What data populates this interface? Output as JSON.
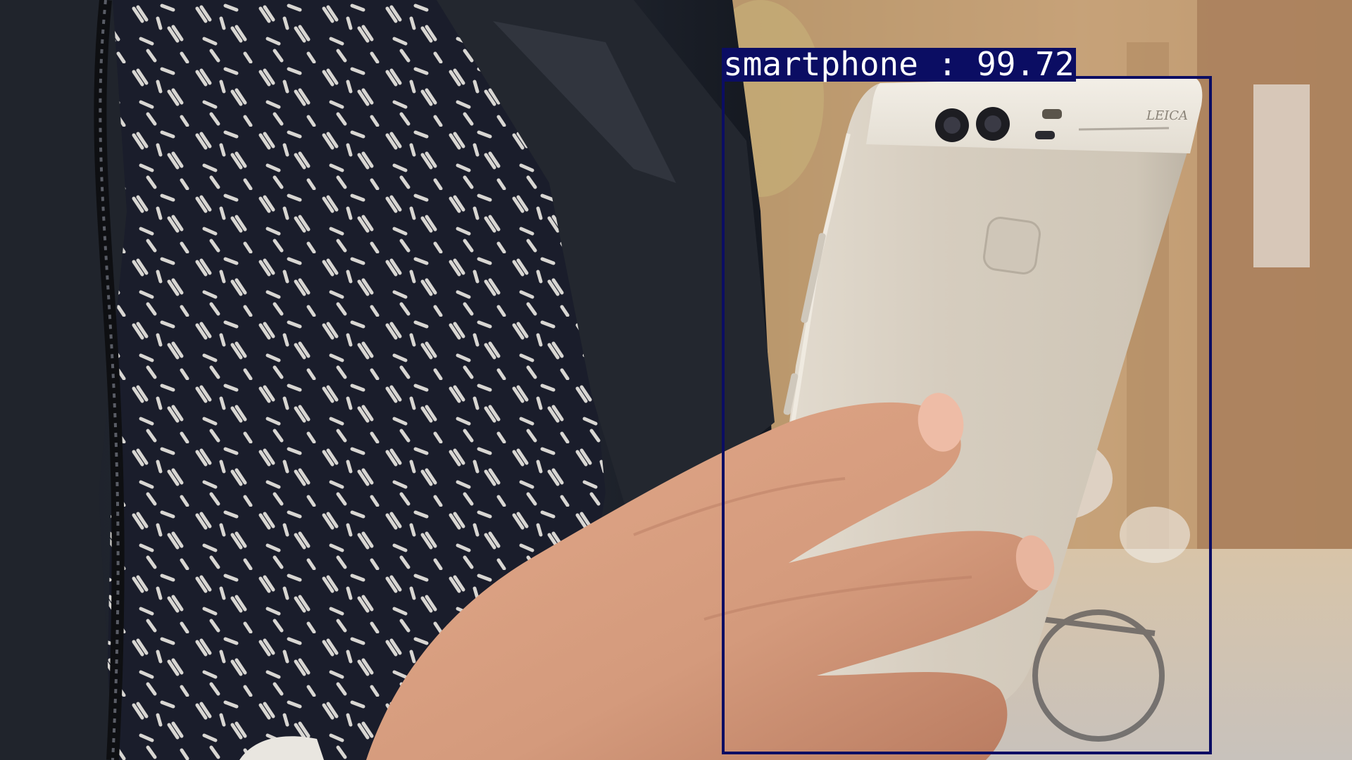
{
  "detection": {
    "label": "smartphone",
    "separator": " : ",
    "score": "99.72",
    "box_color": "#0b0d63",
    "text_color": "#ffffff"
  },
  "scene": {
    "subject": "hand-holding-phone",
    "phone_brand_text": "LEICA"
  }
}
